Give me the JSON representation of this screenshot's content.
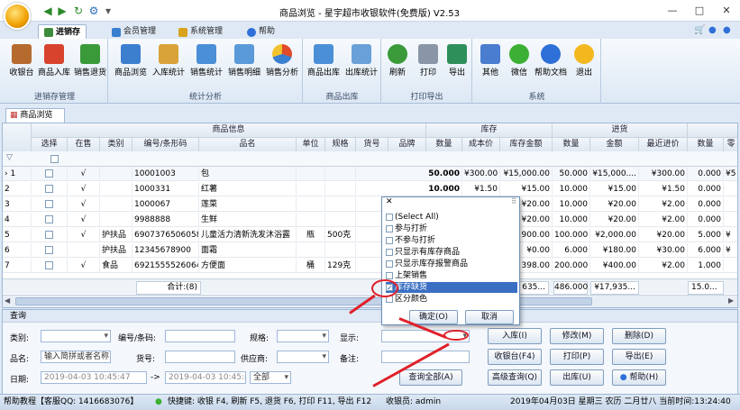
{
  "window": {
    "title": "商品浏览 - 星宇超市收银软件(免费版) V2.53",
    "controls": [
      "□",
      "✕"
    ]
  },
  "tabs": [
    {
      "label": "进销存",
      "active": true
    },
    {
      "label": "会员管理",
      "active": false
    },
    {
      "label": "系统管理",
      "active": false
    },
    {
      "label": "帮助",
      "active": false
    }
  ],
  "ribbon": {
    "groups": [
      {
        "label": "进销存管理",
        "buttons": [
          "收银台",
          "商品入库",
          "销售退货"
        ]
      },
      {
        "label": "统计分析",
        "buttons": [
          "商品浏览",
          "入库统计",
          "销售统计",
          "销售明细",
          "销售分析"
        ]
      },
      {
        "label": "商品出库",
        "buttons": [
          "商品出库",
          "出库统计"
        ]
      },
      {
        "label": "打印导出",
        "buttons": [
          "刷新",
          "打印",
          "导出"
        ]
      },
      {
        "label": "系统",
        "buttons": [
          "其他",
          "微信",
          "帮助文档",
          "退出"
        ]
      }
    ]
  },
  "doc_tab": "商品浏览",
  "grid": {
    "group_headers": {
      "product_info": "商品信息",
      "stock": "库存",
      "purchase": "进货"
    },
    "columns": [
      "选择",
      "在售",
      "类别",
      "编号/条形码",
      "品名",
      "单位",
      "规格",
      "货号",
      "品牌",
      "数量",
      "成本价",
      "库存金额",
      "数量",
      "金额",
      "最近进价",
      "数量",
      "零"
    ],
    "rows": [
      {
        "no": "1",
        "sale": "√",
        "cat": "",
        "code": "10001003",
        "name": "包",
        "unit": "",
        "spec": "",
        "qty": "50.000",
        "cost": "¥300.00",
        "amt": "¥15,000.00",
        "pqty": "50.000",
        "pamt": "¥15,000....",
        "plast": "¥300.00",
        "sqty": "0.000",
        "tail": "¥5"
      },
      {
        "no": "2",
        "sale": "√",
        "cat": "",
        "code": "1000331",
        "name": "红薯",
        "unit": "",
        "spec": "",
        "qty": "10.000",
        "cost": "¥1.50",
        "amt": "¥15.00",
        "pqty": "10.000",
        "pamt": "¥15.00",
        "plast": "¥1.50",
        "sqty": "0.000",
        "tail": ""
      },
      {
        "no": "3",
        "sale": "√",
        "cat": "",
        "code": "1000067",
        "name": "莲菜",
        "unit": "",
        "spec": "",
        "qty": "",
        "cost": "",
        "amt": "¥20.00",
        "pqty": "10.000",
        "pamt": "¥20.00",
        "plast": "¥2.00",
        "sqty": "0.000",
        "tail": ""
      },
      {
        "no": "4",
        "sale": "√",
        "cat": "",
        "code": "9988888",
        "name": "生鲜",
        "unit": "",
        "spec": "",
        "qty": "",
        "cost": "",
        "amt": "¥20.00",
        "pqty": "10.000",
        "pamt": "¥20.00",
        "plast": "¥2.00",
        "sqty": "0.000",
        "tail": ""
      },
      {
        "no": "5",
        "sale": "√",
        "cat": "护扶品",
        "code": "6907376506058",
        "name": "儿童活力清新洗发沐浴露",
        "unit": "瓶",
        "spec": "500克",
        "qty": "",
        "cost": "",
        "amt": "900.00",
        "pqty": "100.000",
        "pamt": "¥2,000.00",
        "plast": "¥20.00",
        "sqty": "5.000",
        "tail": "¥"
      },
      {
        "no": "6",
        "sale": "",
        "cat": "护扶品",
        "code": "12345678900",
        "name": "面霜",
        "unit": "",
        "spec": "",
        "qty": "",
        "cost": "",
        "amt": "¥0.00",
        "pqty": "6.000",
        "pamt": "¥180.00",
        "plast": "¥30.00",
        "sqty": "6.000",
        "tail": "¥"
      },
      {
        "no": "7",
        "sale": "√",
        "cat": "食品",
        "code": "6921555526064",
        "name": "方便面",
        "unit": "桶",
        "spec": "129克",
        "qty": "",
        "cost": "",
        "amt": "398.00",
        "pqty": "200.000",
        "pamt": "¥400.00",
        "plast": "¥2.00",
        "sqty": "1.000",
        "tail": ""
      }
    ],
    "summary": {
      "label": "合计:(8)",
      "amt": "635...",
      "pqty": "486.000",
      "pamt": "¥17,935...",
      "sqty": "15.0..."
    }
  },
  "filter_popup": {
    "items": [
      {
        "label": "(Select All)",
        "checked": false,
        "selected": false
      },
      {
        "label": "参与打折",
        "checked": false,
        "selected": false
      },
      {
        "label": "不参与打折",
        "checked": false,
        "selected": false
      },
      {
        "label": "只显示有库存商品",
        "checked": false,
        "selected": false
      },
      {
        "label": "只显示库存报警商品",
        "checked": false,
        "selected": false
      },
      {
        "label": "上架销售",
        "checked": false,
        "selected": false
      },
      {
        "label": "库存缺货",
        "checked": true,
        "selected": true
      },
      {
        "label": "区分颜色",
        "checked": false,
        "selected": false
      }
    ],
    "ok": "确定(O)",
    "cancel": "取消"
  },
  "query": {
    "title": "查询",
    "category_label": "类别:",
    "code_label": "编号/条码:",
    "spec_label": "规格:",
    "display_label": "显示:",
    "name_label": "品名:",
    "name_placeholder": "输入简拼或者名称",
    "item_no_label": "货号:",
    "supplier_label": "供应商:",
    "remark_label": "备注:",
    "date_label": "日期:",
    "date_from": "2019-04-03 10:45:47",
    "date_to": "2019-04-03 10:45:47",
    "all_option": "全部",
    "buttons": {
      "stock_in": "入库(I)",
      "edit": "修改(M)",
      "delete": "删除(D)",
      "cashier": "收银台(F4)",
      "print": "打印(P)",
      "export": "导出(E)",
      "query_all": "查询全部(A)",
      "advanced": "高级查询(Q)",
      "stock_out": "出库(U)",
      "help": "帮助(H)"
    }
  },
  "status": {
    "help": "帮助教程【客服QQ: 1416683076】",
    "shortcuts": "快捷键: 收银 F4, 刷新 F5, 退货 F6, 打印 F11, 导出 F12",
    "cashier": "收银员: admin",
    "datetime": "2019年04月03日 星期三 农历 二月廿八 当前时间:13:24:40"
  }
}
